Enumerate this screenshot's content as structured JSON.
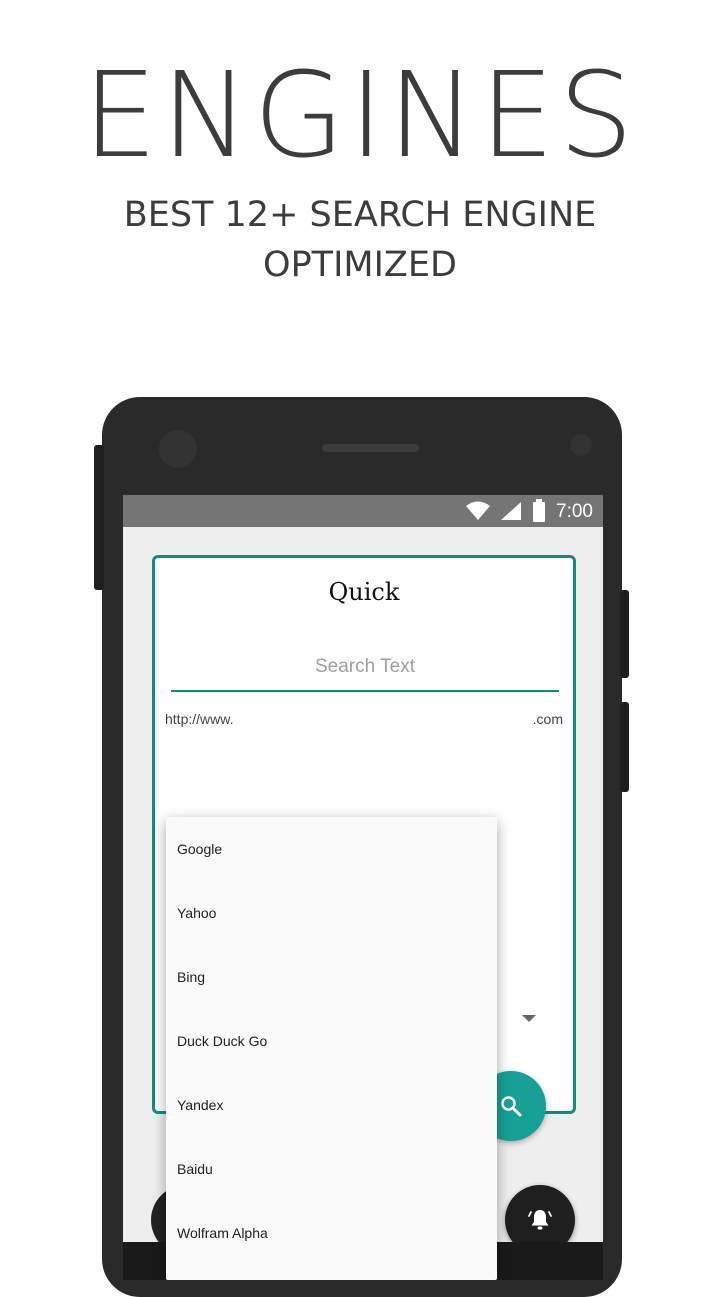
{
  "promo": {
    "headline": "ENGINES",
    "subline1": "BEST 12+ SEARCH ENGINE",
    "subline2": "OPTIMIZED"
  },
  "status_bar": {
    "time": "7:00",
    "icons": [
      "wifi-icon",
      "signal-icon",
      "battery-icon"
    ]
  },
  "card": {
    "title": "Quick",
    "search_placeholder": "Search Text",
    "url_prefix": "http://www.",
    "url_suffix": ".com"
  },
  "dropdown": {
    "items": [
      "Google",
      "Yahoo",
      "Bing",
      "Duck Duck Go",
      "Yandex",
      "Baidu",
      "Wolfram Alpha"
    ]
  },
  "fabs": {
    "search_icon": "search-icon",
    "bell_icon": "notification-bell-icon"
  },
  "colors": {
    "accent": "#128c7e",
    "fab": "#17a196",
    "status_bar": "#757575",
    "headline_text": "#3c3c3c"
  }
}
